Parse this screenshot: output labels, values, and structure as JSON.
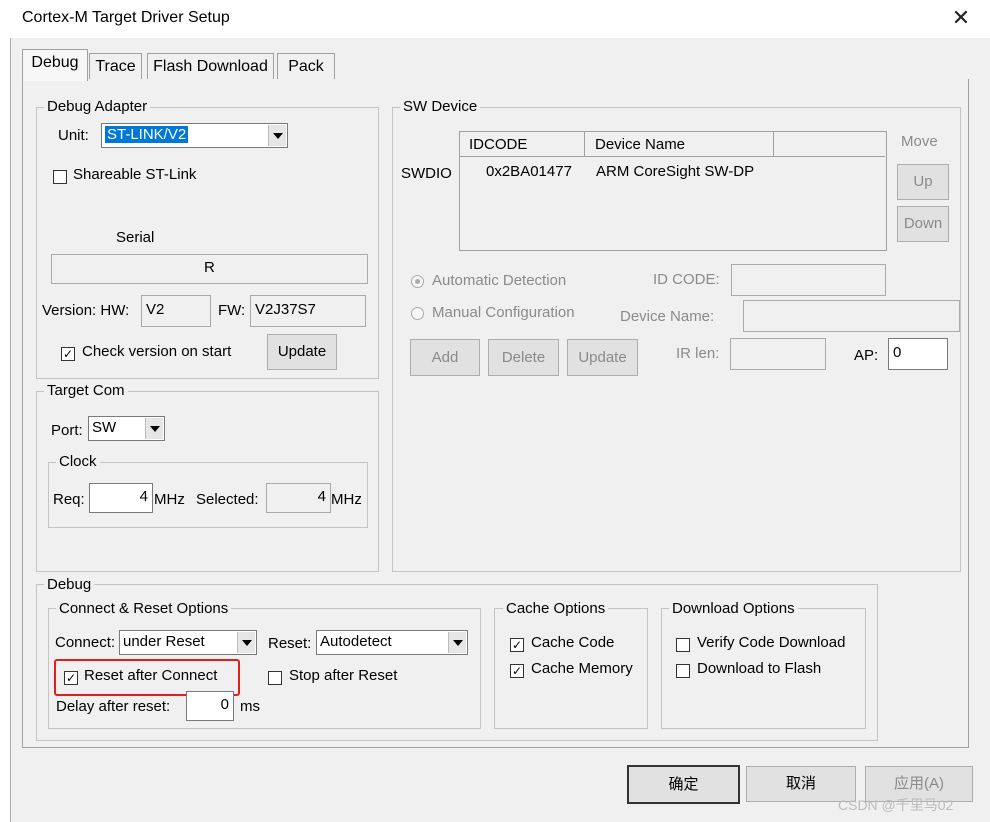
{
  "window": {
    "title": "Cortex-M Target Driver Setup",
    "close_glyph": "✕"
  },
  "tabs": [
    {
      "label": "Debug",
      "active": true
    },
    {
      "label": "Trace"
    },
    {
      "label": "Flash Download"
    },
    {
      "label": "Pack"
    }
  ],
  "debug_adapter": {
    "group_label": "Debug Adapter",
    "unit_label": "Unit:",
    "unit_value": "ST-LINK/V2",
    "shareable_label": "Shareable ST-Link",
    "shareable_checked": false,
    "serial_label": "Serial",
    "serial_value": "R",
    "version_label": "Version: HW:",
    "hw_value": "V2",
    "fw_label": "FW:",
    "fw_value": "V2J37S7",
    "check_version_label": "Check version on start",
    "check_version_checked": true,
    "update_button": "Update"
  },
  "target_com": {
    "group_label": "Target Com",
    "port_label": "Port:",
    "port_value": "SW",
    "clock_label": "Clock",
    "req_label": "Req:",
    "req_value": "4",
    "mhz": "MHz",
    "selected_label": "Selected:",
    "selected_value": "4"
  },
  "sw_device": {
    "group_label": "SW Device",
    "swdio_label": "SWDIO",
    "columns": [
      "IDCODE",
      "Device Name"
    ],
    "rows": [
      {
        "idcode": "0x2BA01477",
        "device_name": "ARM CoreSight SW-DP"
      }
    ],
    "move_label": "Move",
    "up_button": "Up",
    "down_button": "Down",
    "auto_detect_label": "Automatic Detection",
    "manual_config_label": "Manual Configuration",
    "id_code_label": "ID CODE:",
    "device_name_label": "Device Name:",
    "add_button": "Add",
    "delete_button": "Delete",
    "update_button": "Update",
    "ir_len_label": "IR len:",
    "ap_label": "AP:",
    "ap_value": "0"
  },
  "debug": {
    "group_label": "Debug",
    "connect_reset": {
      "group_label": "Connect & Reset Options",
      "connect_label": "Connect:",
      "connect_value": "under Reset",
      "reset_label": "Reset:",
      "reset_value": "Autodetect",
      "reset_after_connect_label": "Reset after Connect",
      "reset_after_connect_checked": true,
      "stop_after_reset_label": "Stop after Reset",
      "stop_after_reset_checked": false,
      "delay_label": "Delay after reset:",
      "delay_value": "0",
      "ms": "ms"
    },
    "cache": {
      "group_label": "Cache Options",
      "cache_code_label": "Cache Code",
      "cache_code_checked": true,
      "cache_memory_label": "Cache Memory",
      "cache_memory_checked": true
    },
    "download": {
      "group_label": "Download Options",
      "verify_label": "Verify Code Download",
      "verify_checked": false,
      "download_flash_label": "Download to Flash",
      "download_flash_checked": false
    }
  },
  "footer": {
    "ok_button": "确定",
    "cancel_button": "取消",
    "apply_button": "应用(A)"
  },
  "watermark": "CSDN @千里马02",
  "highlight_color": "#e0201c",
  "selection_color": "#0078d7"
}
